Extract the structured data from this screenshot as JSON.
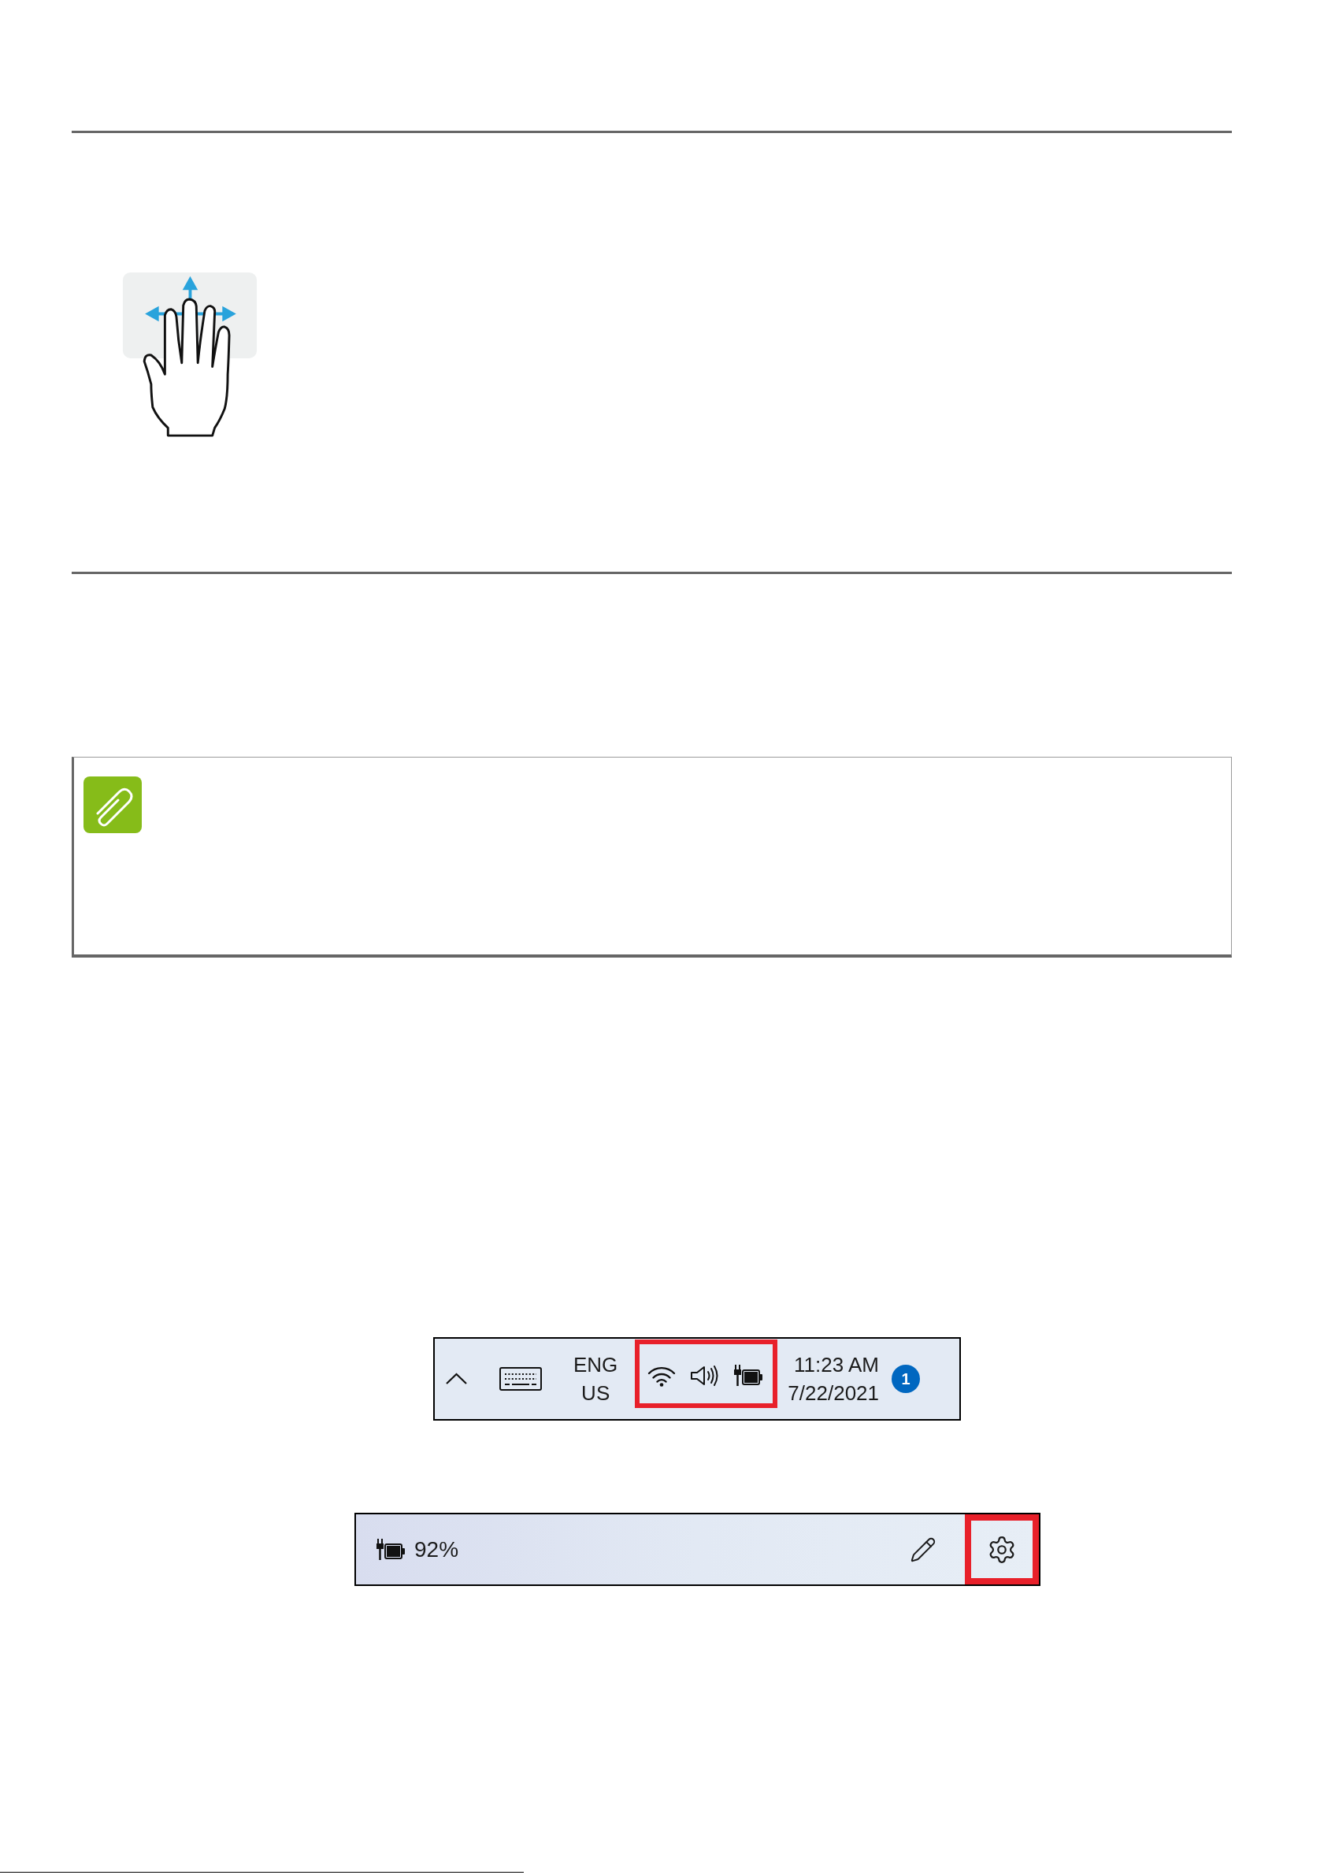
{
  "taskbar": {
    "language": {
      "line_1": "ENG",
      "line_2": "US"
    },
    "status_icons": {
      "highlighted": true
    },
    "clock": {
      "time": "11:23 AM",
      "date": "7/22/2021"
    },
    "notification_badge": "1"
  },
  "battery_flyout": {
    "battery_percentage": "92%",
    "settings_button": {
      "highlighted": true
    }
  }
}
